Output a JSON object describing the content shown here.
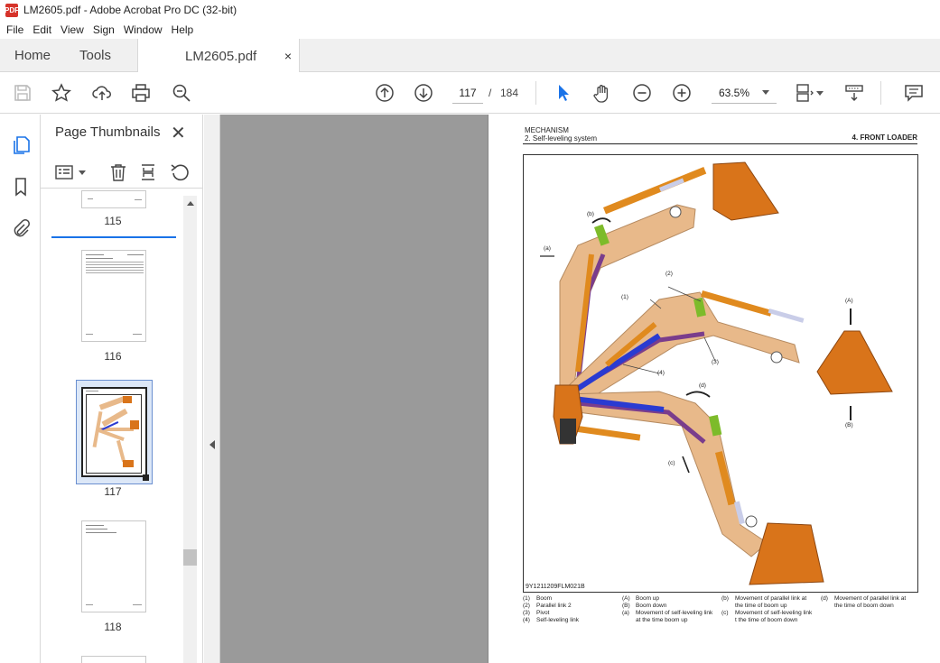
{
  "window": {
    "title": "LM2605.pdf - Adobe Acrobat Pro DC (32-bit)",
    "app_logo": "PDF"
  },
  "menu": [
    "File",
    "Edit",
    "View",
    "Sign",
    "Window",
    "Help"
  ],
  "tabs": {
    "home": "Home",
    "tools": "Tools",
    "document": "LM2605.pdf",
    "close": "×"
  },
  "toolbar": {
    "page_current": "117",
    "page_separator": "/",
    "page_total": "184",
    "zoom": "63.5%",
    "icons": [
      "save-icon",
      "bookmark-star-icon",
      "upload-cloud-icon",
      "print-icon",
      "search-zoom-icon",
      "page-up-icon",
      "page-down-icon",
      "select-arrow-icon",
      "hand-icon",
      "zoom-out-icon",
      "zoom-in-icon",
      "fit-page-icon",
      "scroll-mode-icon",
      "comment-icon"
    ]
  },
  "sidebar": {
    "title": "Page Thumbnails",
    "close": "✕",
    "thumbnails": [
      {
        "label": "115"
      },
      {
        "label": "116"
      },
      {
        "label": "117"
      },
      {
        "label": "118"
      }
    ],
    "selected_page": "117"
  },
  "document": {
    "header_line1": "MECHANISM",
    "header_line2": "2. Self-leveling system",
    "header_right": "4. FRONT LOADER",
    "figure_id": "9Y1211209FLM021B",
    "figure_labels": {
      "a": "(a)",
      "b": "(b)",
      "c": "(c)",
      "d": "(d)",
      "one": "(1)",
      "two": "(2)",
      "three": "(3)",
      "four": "(4)",
      "A": "(A)",
      "B": "(B)"
    },
    "legend_col1": [
      {
        "key": "(1)",
        "text": "Boom"
      },
      {
        "key": "(2)",
        "text": "Parallel link 2"
      },
      {
        "key": "(3)",
        "text": "Pivot"
      },
      {
        "key": "(4)",
        "text": "Self-leveling link"
      }
    ],
    "legend_col2": [
      {
        "key": "(A)",
        "text": "Boom up"
      },
      {
        "key": "(B)",
        "text": "Boom down"
      },
      {
        "key": "(a)",
        "text": "Movement of self-leveling link"
      },
      {
        "key": "",
        "text": "at the time boom up"
      }
    ],
    "legend_col3": [
      {
        "key": "(b)",
        "text": "Movement of parallel link at"
      },
      {
        "key": "",
        "text": "the time of boom up"
      },
      {
        "key": "(c)",
        "text": "Movement of self-leveling link"
      },
      {
        "key": "",
        "text": "t the time of boom down"
      }
    ],
    "legend_col4": [
      {
        "key": "(d)",
        "text": "Movement of parallel link at"
      },
      {
        "key": "",
        "text": "the time of boom down"
      }
    ]
  },
  "colors": {
    "accent": "#1a73e8",
    "boom": "#e8b98a",
    "cylinder": "#e08a1e",
    "link_blue": "#2a3bd1",
    "link_purple": "#7a3d8c",
    "link_green": "#7dbb2a",
    "bucket": "#d9741a"
  }
}
